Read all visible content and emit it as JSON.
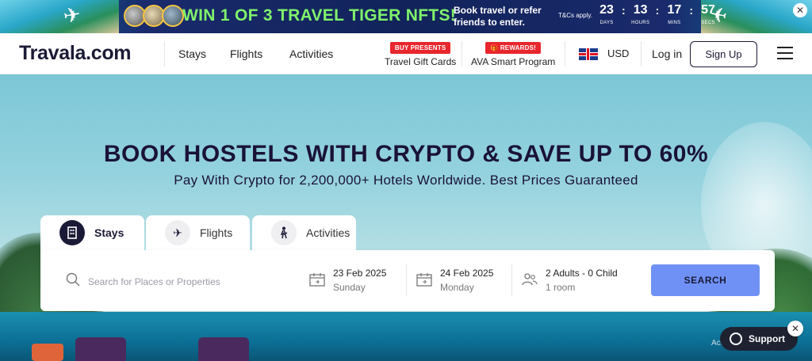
{
  "promo": {
    "headline": "WIN 1 OF 3 TRAVEL TIGER NFTS!",
    "subtext": "Book travel or refer friends to enter.",
    "tnc": "T&Cs apply.",
    "countdown": [
      {
        "value": "23",
        "label": "DAYS"
      },
      {
        "value": "13",
        "label": "HOURS"
      },
      {
        "value": "17",
        "label": "MINS"
      },
      {
        "value": "57",
        "label": "SECS"
      }
    ],
    "close_icon": "close-icon"
  },
  "header": {
    "logo": "Travala.com",
    "nav": [
      "Stays",
      "Flights",
      "Activities"
    ],
    "gift_cards": {
      "tag": "BUY PRESENTS",
      "label": "Travel Gift Cards"
    },
    "ava": {
      "tag": "🎁 REWARDS!",
      "label": "AVA Smart Program"
    },
    "currency": "USD",
    "login": "Log in",
    "signup": "Sign Up",
    "flag_icon": "uk-flag-icon"
  },
  "hero": {
    "title": "BOOK HOSTELS WITH CRYPTO & SAVE UP TO 60%",
    "subtitle": "Pay With Crypto for 2,200,000+ Hotels Worldwide. Best Prices Guaranteed"
  },
  "tabs": [
    {
      "label": "Stays",
      "icon": "building-icon",
      "active": true
    },
    {
      "label": "Flights",
      "icon": "airplane-icon",
      "active": false
    },
    {
      "label": "Activities",
      "icon": "hiker-icon",
      "active": false
    }
  ],
  "search": {
    "placeholder": "Search for Places or Properties",
    "checkin": {
      "date": "23 Feb 2025",
      "day": "Sunday"
    },
    "checkout": {
      "date": "24 Feb 2025",
      "day": "Monday"
    },
    "guests": {
      "summary": "2 Adults - 0 Child",
      "rooms": "1 room"
    },
    "button": "SEARCH"
  },
  "support": {
    "label": "Support"
  },
  "watermark": "Activate Windows",
  "colors": {
    "brand_dark": "#1b1a36",
    "search_button": "#6f91f5",
    "promo_green": "#7ff26b",
    "promo_tag_red": "#e8262d"
  }
}
